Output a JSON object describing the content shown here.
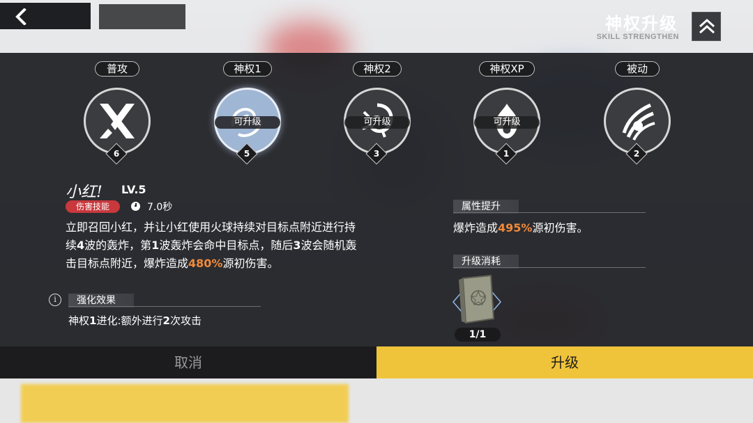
{
  "header": {
    "title": "神权升级",
    "subtitle": "SKILL STRENGTHEN"
  },
  "skills": [
    {
      "label": "普攻",
      "level": "6",
      "status": "",
      "icon": "x-slash-icon"
    },
    {
      "label": "神权1",
      "level": "5",
      "status": "可升级",
      "icon": "fire-wisp-icon"
    },
    {
      "label": "神权2",
      "level": "3",
      "status": "可升级",
      "icon": "swirl-icon"
    },
    {
      "label": "神权XP",
      "level": "1",
      "status": "可升级",
      "icon": "flame-icon"
    },
    {
      "label": "被动",
      "level": "2",
      "status": "",
      "icon": "claw-icon"
    }
  ],
  "detail": {
    "name": "小红!",
    "level": "LV.5",
    "type_badge": "伤害技能",
    "cooldown": "7.0秒",
    "desc_1": "立即召回小红，并让小红使用火球持续对目标点附近进行持",
    "desc_2a": "续",
    "desc_2b": "4",
    "desc_2c": "波的轰炸，第",
    "desc_2d": "1",
    "desc_2e": "波轰炸会命中目标点，随后",
    "desc_2f": "3",
    "desc_2g": "波会随机轰",
    "desc_3a": "击目标点附近，爆炸造成",
    "desc_3b": "480%",
    "desc_3c": "源初伤害。"
  },
  "enhance": {
    "heading": "强化效果",
    "text_a": "神权",
    "text_b": "1",
    "text_c": "进化:额外进行",
    "text_d": "2",
    "text_e": "次攻击"
  },
  "attribute": {
    "heading": "属性提升",
    "text_a": "爆炸造成",
    "text_b": "495%",
    "text_c": "源初伤害。"
  },
  "cost": {
    "heading": "升级消耗",
    "count": "1/1",
    "item_icon": "book-icon"
  },
  "buttons": {
    "cancel": "取消",
    "upgrade": "升级"
  },
  "colors": {
    "accent_yellow": "#f0c43a",
    "highlight_orange": "#f08a3a",
    "damage_badge_red": "#c8383d"
  }
}
